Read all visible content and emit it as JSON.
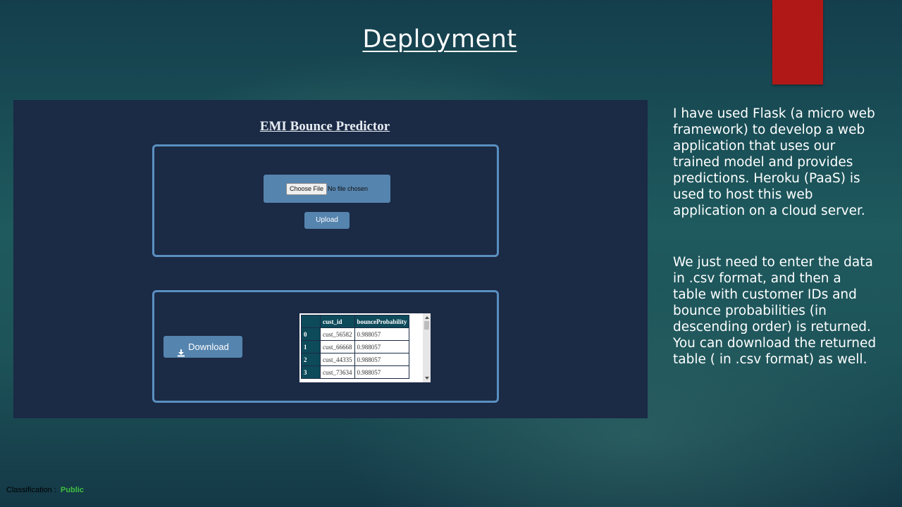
{
  "slide": {
    "title": "Deployment",
    "accent_color": "#b01818",
    "paragraphs": [
      "I have used Flask (a micro web framework) to develop a web application that uses our trained model and provides predictions. Heroku (PaaS) is used to host this web application on a cloud server.",
      "We just need to enter the data in .csv format, and then a table with customer IDs and bounce probabilities (in descending order) is returned. You can download the returned table ( in .csv format) as well."
    ],
    "classification": {
      "label": "Classification :",
      "value": "Public",
      "value_color": "#3fbf3f"
    }
  },
  "app": {
    "title": "EMI Bounce Predictor",
    "upload": {
      "choose_file_label": "Choose File",
      "no_file_text": "No file chosen",
      "upload_label": "Upload"
    },
    "result": {
      "download_label": "Download",
      "download_icon": "download-icon",
      "table": {
        "headers": [
          "",
          "cust_id",
          "bounceProbability"
        ],
        "rows": [
          {
            "idx": "0",
            "cust_id": "cust_56582",
            "prob": "0.988057"
          },
          {
            "idx": "1",
            "cust_id": "cust_66668",
            "prob": "0.988057"
          },
          {
            "idx": "2",
            "cust_id": "cust_44335",
            "prob": "0.988057"
          },
          {
            "idx": "3",
            "cust_id": "cust_73634",
            "prob": "0.988057"
          }
        ]
      }
    },
    "colors": {
      "background": "#1b2a45",
      "panel_border": "#5a8fc0",
      "button": "#5584ae",
      "table_header": "#0d4a5a"
    }
  }
}
